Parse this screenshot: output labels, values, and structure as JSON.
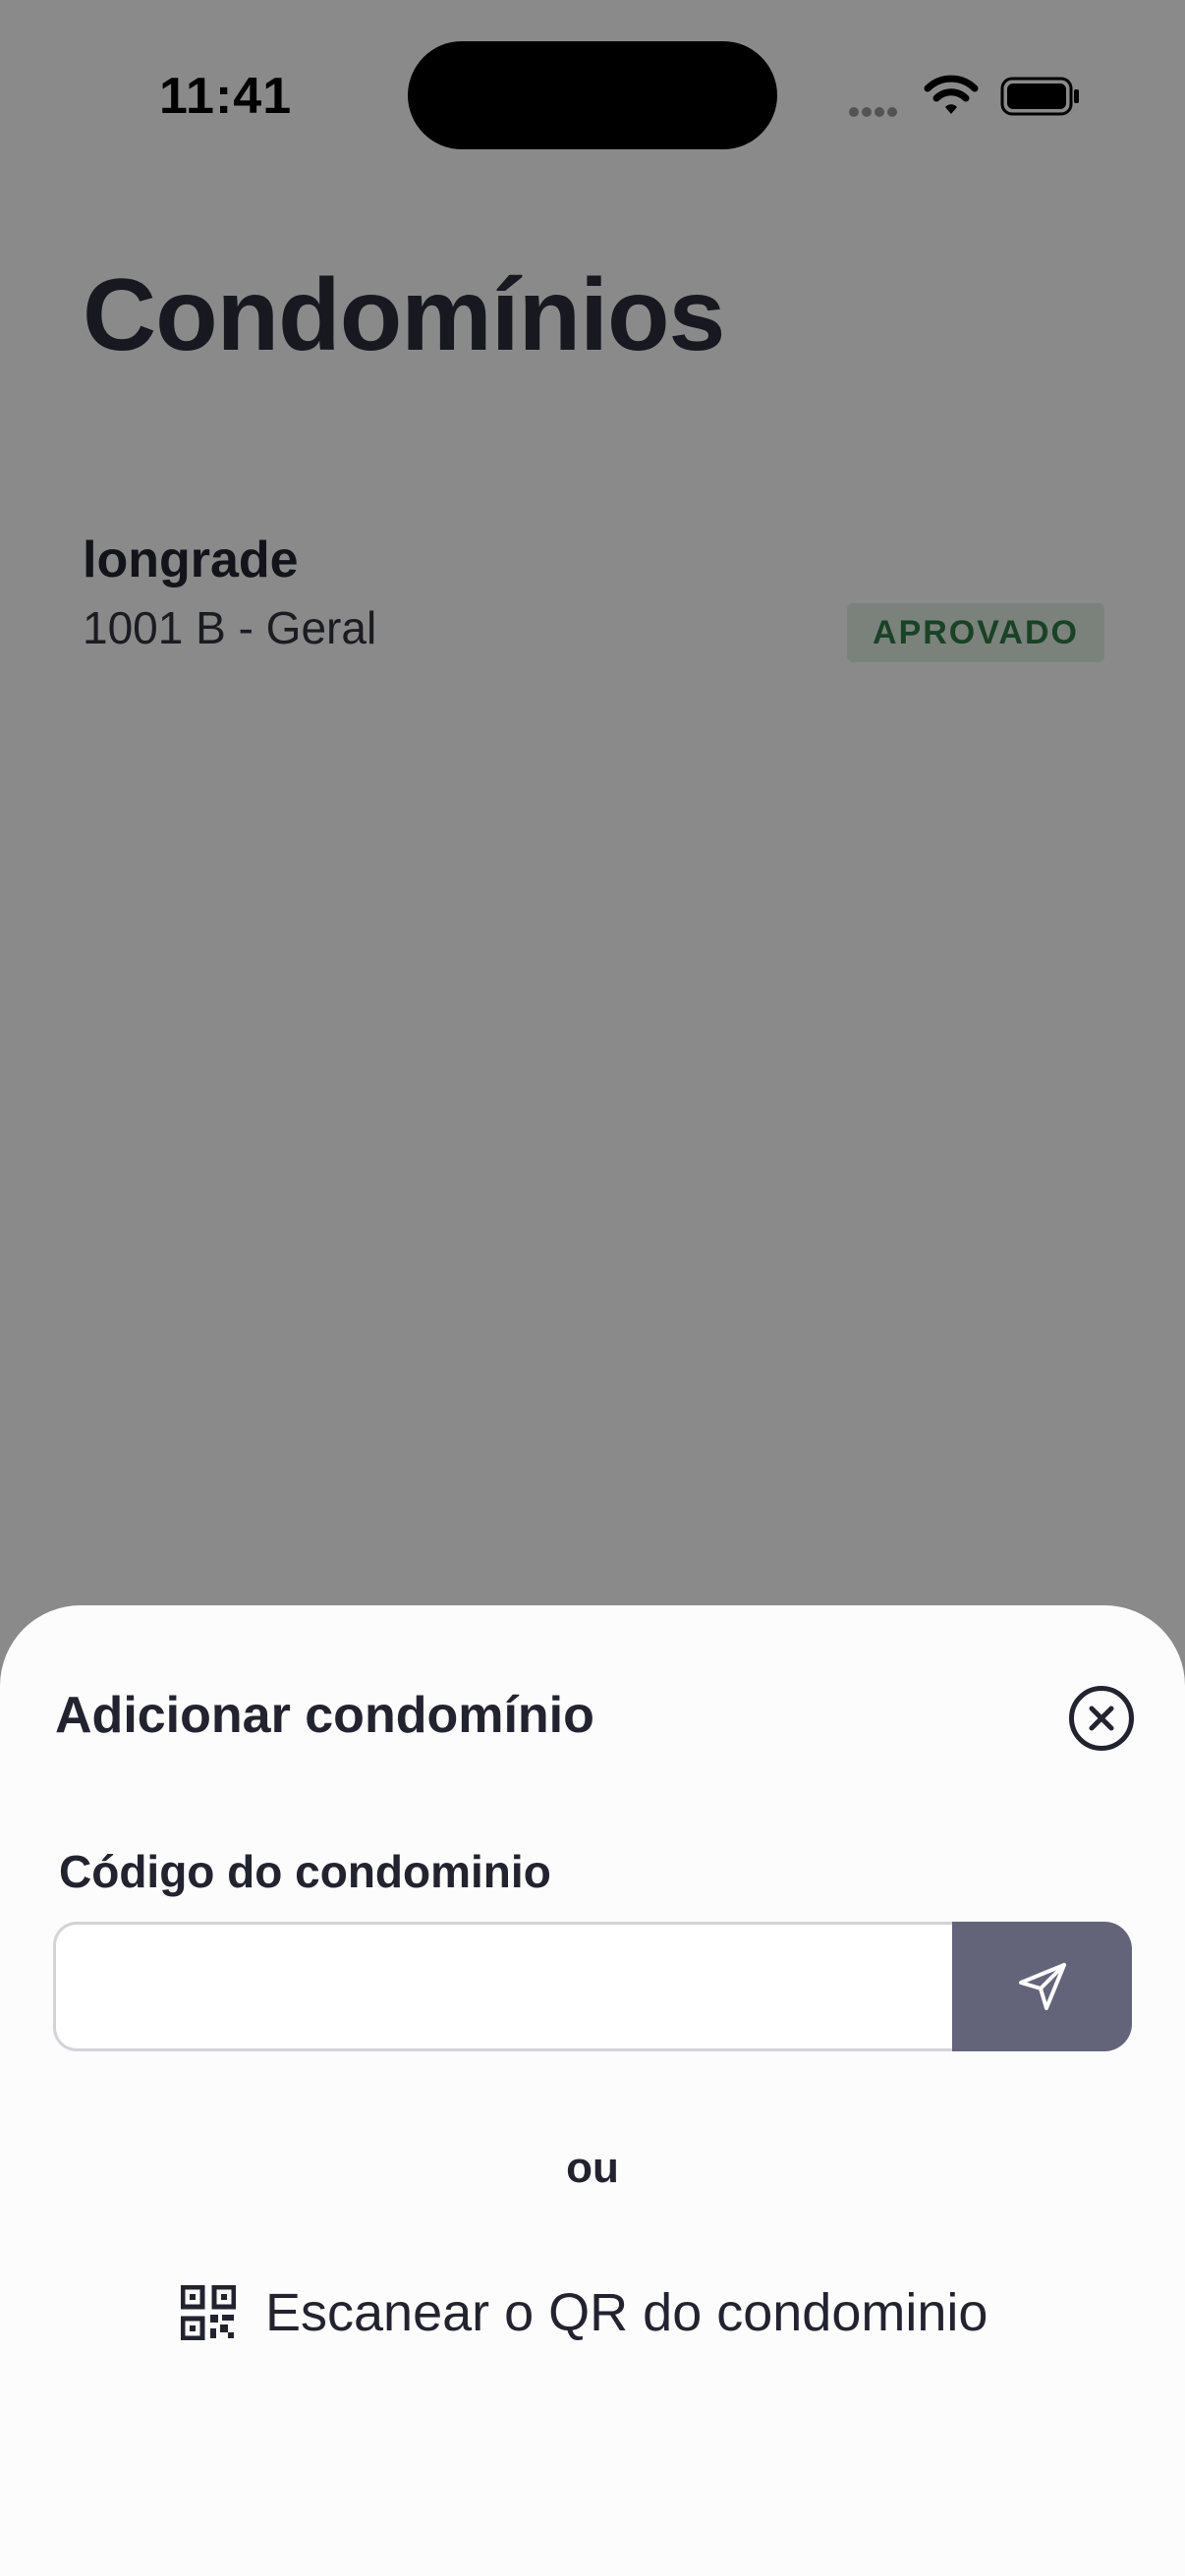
{
  "status_bar": {
    "time": "11:41",
    "icons": [
      "signal-icon",
      "wifi-icon",
      "battery-icon"
    ]
  },
  "page": {
    "title": "Condomínios"
  },
  "condominiums": [
    {
      "name": "longrade",
      "unit": "1001 B - Geral",
      "status": "APROVADO"
    }
  ],
  "colors": {
    "status_approved_bg": "#e3f0e5",
    "status_approved_text": "#2f7a46",
    "send_button_bg": "#63637a",
    "overlay": "rgba(0,0,0,0.46)"
  },
  "sheet": {
    "title": "Adicionar condomínio",
    "close_icon": "close-circle-icon",
    "field_label": "Código do condominio",
    "code_input": {
      "value": "",
      "placeholder": ""
    },
    "send_icon": "send-icon",
    "or_text": "ou",
    "scan_icon": "qr-code-icon",
    "scan_label": "Escanear o QR do condominio"
  }
}
